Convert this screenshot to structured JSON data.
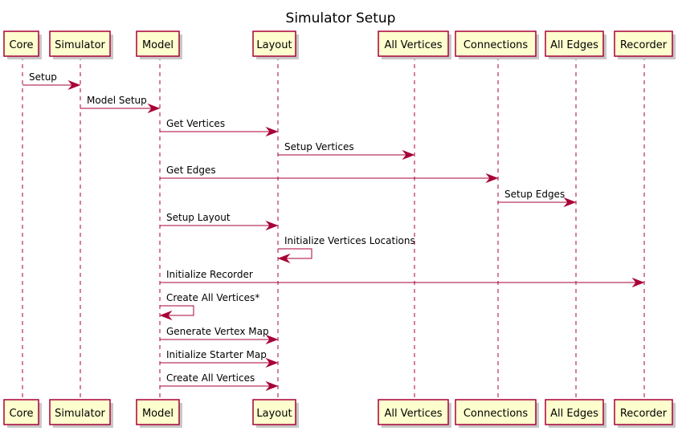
{
  "title": "Simulator Setup",
  "colors": {
    "participant_fill": "#FEFECE",
    "participant_border": "#A80036",
    "arrow": "#A80036",
    "lifeline": "#A80036",
    "shadow": "#c8c8c8"
  },
  "participants": [
    {
      "id": "core",
      "label": "Core"
    },
    {
      "id": "simulator",
      "label": "Simulator"
    },
    {
      "id": "model",
      "label": "Model"
    },
    {
      "id": "layout",
      "label": "Layout"
    },
    {
      "id": "all_vertices",
      "label": "All Vertices"
    },
    {
      "id": "connections",
      "label": "Connections"
    },
    {
      "id": "all_edges",
      "label": "All Edges"
    },
    {
      "id": "recorder",
      "label": "Recorder"
    }
  ],
  "messages": [
    {
      "from": "core",
      "to": "simulator",
      "label": "Setup"
    },
    {
      "from": "simulator",
      "to": "model",
      "label": "Model Setup"
    },
    {
      "from": "model",
      "to": "layout",
      "label": "Get Vertices"
    },
    {
      "from": "layout",
      "to": "all_vertices",
      "label": "Setup Vertices"
    },
    {
      "from": "model",
      "to": "connections",
      "label": "Get Edges"
    },
    {
      "from": "connections",
      "to": "all_edges",
      "label": "Setup Edges"
    },
    {
      "from": "model",
      "to": "layout",
      "label": "Setup Layout"
    },
    {
      "from": "layout",
      "to": "layout",
      "label": "Initialize Vertices Locations"
    },
    {
      "from": "model",
      "to": "recorder",
      "label": "Initialize Recorder"
    },
    {
      "from": "model",
      "to": "model",
      "label": "Create All Vertices*"
    },
    {
      "from": "model",
      "to": "layout",
      "label": "Generate Vertex Map"
    },
    {
      "from": "model",
      "to": "layout",
      "label": "Initialize Starter Map"
    },
    {
      "from": "model",
      "to": "layout",
      "label": "Create All Vertices"
    }
  ]
}
